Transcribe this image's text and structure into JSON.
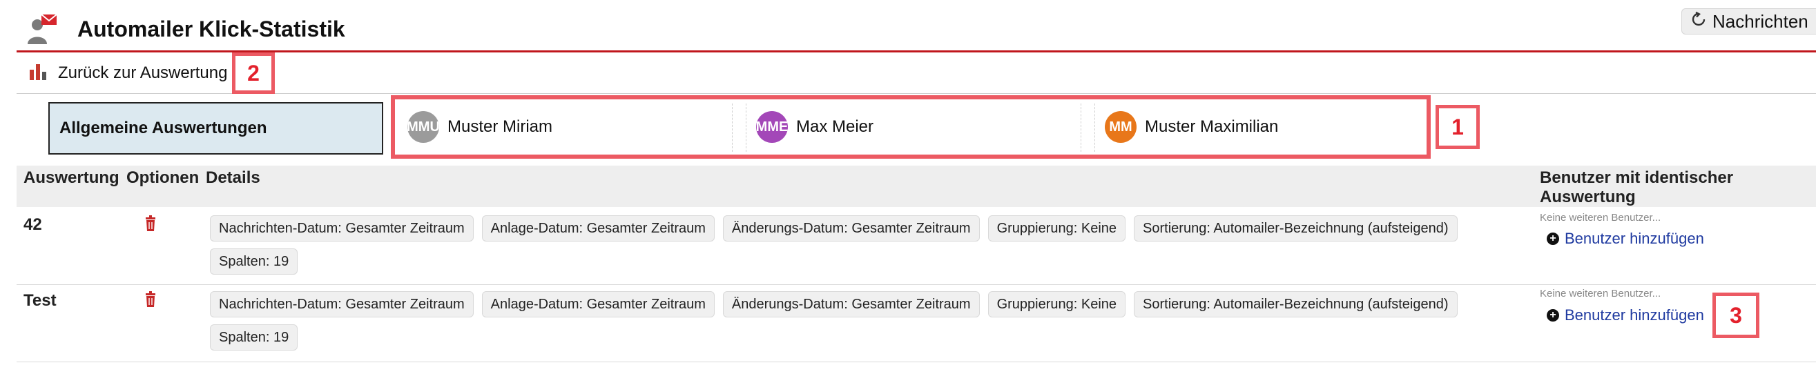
{
  "header": {
    "title": "Automailer Klick-Statistik",
    "reload_label": "Nachrichten",
    "accent_color": "#c0161c"
  },
  "toolbar": {
    "back_label": "Zurück zur Auswertung"
  },
  "markers": [
    "1",
    "2",
    "3"
  ],
  "tabs": {
    "general_label": "Allgemeine Auswertungen",
    "users": [
      {
        "initials": "MMU",
        "name": "Muster Miriam",
        "color": "#9b9b9b"
      },
      {
        "initials": "MME",
        "name": "Max Meier",
        "color": "#a347b8"
      },
      {
        "initials": "MM",
        "name": "Muster Maximilian",
        "color": "#e8771a"
      }
    ]
  },
  "table": {
    "columns": [
      "Auswertung",
      "Optionen",
      "Details",
      "Benutzer mit identischer Auswertung"
    ],
    "rows": [
      {
        "name": "42",
        "details": [
          "Nachrichten-Datum: Gesamter Zeitraum",
          "Anlage-Datum: Gesamter Zeitraum",
          "Änderungs-Datum: Gesamter Zeitraum",
          "Gruppierung: Keine",
          "Sortierung: Automailer-Bezeichnung (aufsteigend)",
          "Spalten: 19"
        ],
        "no_more_users": "Keine weiteren Benutzer...",
        "add_user_label": "Benutzer hinzufügen"
      },
      {
        "name": "Test",
        "details": [
          "Nachrichten-Datum: Gesamter Zeitraum",
          "Anlage-Datum: Gesamter Zeitraum",
          "Änderungs-Datum: Gesamter Zeitraum",
          "Gruppierung: Keine",
          "Sortierung: Automailer-Bezeichnung (aufsteigend)",
          "Spalten: 19"
        ],
        "no_more_users": "Keine weiteren Benutzer...",
        "add_user_label": "Benutzer hinzufügen"
      }
    ]
  },
  "icons": {
    "app": "user-mail-icon",
    "reload": "reload-icon",
    "back": "bar-chart-icon",
    "delete": "trash-icon",
    "add": "plus-circle-icon"
  }
}
